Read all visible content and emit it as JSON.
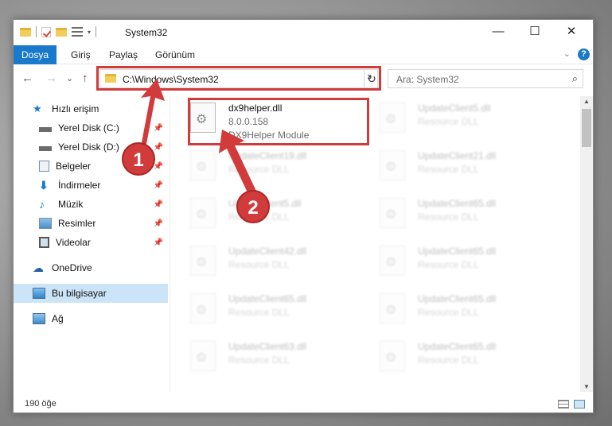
{
  "titlebar": {
    "title": "System32",
    "minimize": "—",
    "maximize": "☐",
    "close": "✕",
    "dropdown": "▾"
  },
  "ribbon": {
    "tabs": [
      "Dosya",
      "Giriş",
      "Paylaş",
      "Görünüm"
    ],
    "help": "?",
    "collapse": "⌄"
  },
  "navbar": {
    "back": "←",
    "forward": "→",
    "recent": "⌄",
    "up": "↑",
    "address": "C:\\Windows\\System32",
    "address_dropdown": "⌄",
    "refresh": "↻",
    "search_placeholder": "Ara: System32",
    "search_icon": "⌕"
  },
  "sidebar": {
    "items": [
      {
        "label": "Hızlı erişim",
        "icon": "star-icon",
        "pinned": false
      },
      {
        "label": "Yerel Disk (C:)",
        "icon": "drive-icon",
        "pinned": true
      },
      {
        "label": "Yerel Disk (D:)",
        "icon": "drive-icon",
        "pinned": true
      },
      {
        "label": "Belgeler",
        "icon": "documents-icon",
        "pinned": true
      },
      {
        "label": "İndirmeler",
        "icon": "downloads-icon",
        "pinned": true
      },
      {
        "label": "Müzik",
        "icon": "music-icon",
        "pinned": true
      },
      {
        "label": "Resimler",
        "icon": "pictures-icon",
        "pinned": true
      },
      {
        "label": "Videolar",
        "icon": "videos-icon",
        "pinned": true
      },
      {
        "label": "OneDrive",
        "icon": "cloud-icon",
        "pinned": false
      },
      {
        "label": "Bu bilgisayar",
        "icon": "computer-icon",
        "pinned": false,
        "selected": true
      },
      {
        "label": "Ağ",
        "icon": "network-icon",
        "pinned": false
      }
    ]
  },
  "files": {
    "highlighted": {
      "name": "dx9helper.dll",
      "version": "8.0.0.158",
      "description": "DX9Helper Module"
    },
    "col1": [
      {
        "name": "UpdateClient19.dll",
        "type": "Resource DLL"
      },
      {
        "name": "UpdateClient5.dll",
        "type": "Resource DLL"
      },
      {
        "name": "UpdateClient42.dll",
        "type": "Resource DLL"
      },
      {
        "name": "UpdateClient65.dll",
        "type": "Resource DLL"
      },
      {
        "name": "UpdateClient63.dll",
        "type": "Resource DLL"
      }
    ],
    "col2": [
      {
        "name": "UpdateClient5.dll",
        "type": "Resource DLL"
      },
      {
        "name": "UpdateClient21.dll",
        "type": "Resource DLL"
      },
      {
        "name": "UpdateClient65.dll",
        "type": "Resource DLL"
      },
      {
        "name": "UpdateClient65.dll",
        "type": "Resource DLL"
      },
      {
        "name": "UpdateClient65.dll",
        "type": "Resource DLL"
      },
      {
        "name": "UpdateClient65.dll",
        "type": "Resource DLL"
      }
    ]
  },
  "status": {
    "count": "190 öğe"
  },
  "annotations": {
    "step1": "1",
    "step2": "2",
    "color": "#d23b3b"
  }
}
